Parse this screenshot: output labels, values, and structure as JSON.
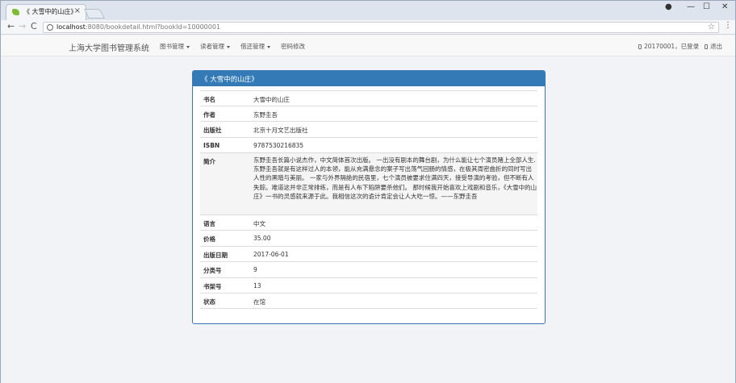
{
  "browser": {
    "tab_title": "《 大雪中的山庄》",
    "tab_close": "×",
    "url_host": "localhost",
    "url_rest": ":8080/bookdetail.html?bookId=10000001",
    "controls": {
      "profile": "●",
      "minimize": "—",
      "maximize": "☐",
      "close": "✕"
    },
    "nav": {
      "back": "←",
      "forward": "→",
      "reload": "C"
    },
    "star": "☆",
    "menu": "⋮"
  },
  "navbar": {
    "brand": "上海大学图书管理系统",
    "items": [
      {
        "label": "图书管理",
        "dropdown": true
      },
      {
        "label": "读者管理",
        "dropdown": true
      },
      {
        "label": "借还管理",
        "dropdown": true
      },
      {
        "label": "密码修改",
        "dropdown": false
      }
    ],
    "user_status": "20170001，已登录",
    "logout": "退出"
  },
  "panel": {
    "title": "《 大雪中的山庄》",
    "rows": [
      {
        "label": "书名",
        "value": "大雪中的山庄"
      },
      {
        "label": "作者",
        "value": "东野圭吾"
      },
      {
        "label": "出版社",
        "value": "北京十月文艺出版社"
      },
      {
        "label": "ISBN",
        "value": "9787530216835"
      },
      {
        "label": "简介",
        "value": "东野圭吾长篇小说杰作，中文简体首次出版。 一出没有剧本的舞台剧，为什么能让七个演员赌上全部人生.东野圭吾就是有这样过人的本领，能从充满悬念的案子写出荡气回肠的情感，在极其周密曲折的同时写出人性的黑暗与美丽。 一家与外界隔绝的民宿里，七个演员被要求住满四天，接受导演的考验，但不断有人失踪。难道这并非正常排练，而是有人布下陷阱要杀他们。 那时候我开始喜欢上戏剧和音乐，《大雪中的山庄》一书的灵感就来源于此。我相信这次的诡计肯定会让人大吃一惊。——东野圭吾"
      },
      {
        "label": "语言",
        "value": "中文"
      },
      {
        "label": "价格",
        "value": "35.00"
      },
      {
        "label": "出版日期",
        "value": "2017-06-01"
      },
      {
        "label": "分类号",
        "value": "9"
      },
      {
        "label": "书架号",
        "value": "13"
      },
      {
        "label": "状态",
        "value": "在馆"
      }
    ]
  }
}
